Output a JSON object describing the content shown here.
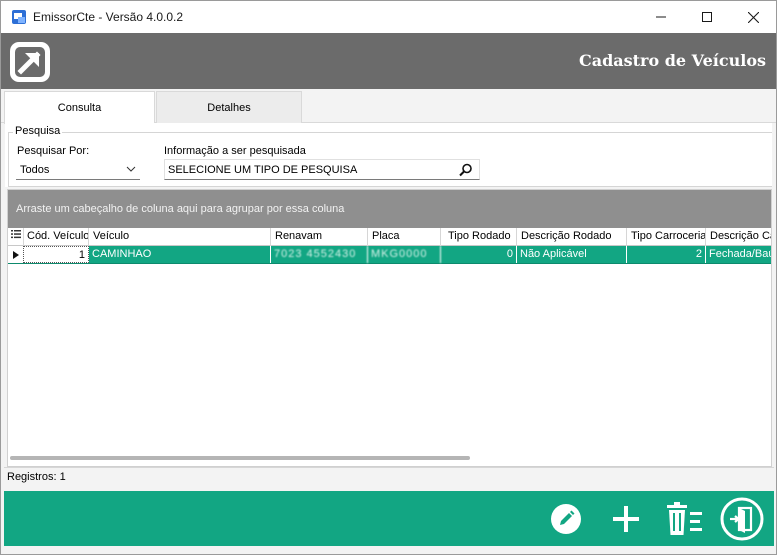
{
  "window": {
    "title": "EmissorCte - Versão 4.0.0.2",
    "icon": "app-icon"
  },
  "header": {
    "title": "Cadastro de Veículos",
    "logo": "arrow-logo-icon",
    "background": "#6b6b6b"
  },
  "tabs": [
    {
      "label": "Consulta",
      "active": true
    },
    {
      "label": "Detalhes",
      "active": false
    }
  ],
  "search": {
    "legend": "Pesquisa",
    "por_label": "Pesquisar Por:",
    "por_value": "Todos",
    "info_label": "Informação a ser pesquisada",
    "info_value": "SELECIONE UM TIPO DE PESQUISA"
  },
  "grid": {
    "group_panel_text": "Arraste um cabeçalho de coluna aqui para agrupar por essa coluna",
    "columns": [
      "Cód. Veículo",
      "Veículo",
      "Renavam",
      "Placa",
      "Tipo Rodado",
      "Descrição Rodado",
      "Tipo Carroceria",
      "Descrição Ca"
    ],
    "rows": [
      {
        "cod": "1",
        "veiculo": "CAMINHAO",
        "renavam": "7023 4552430",
        "placa": "MKG0000",
        "tipo_rodado": "0",
        "descricao_rodado": "Não Aplicável",
        "tipo_carroceria": "2",
        "descricao_carroceria": "Fechada/Baú"
      }
    ],
    "selection_color": "#12a683"
  },
  "status": {
    "registros": "Registros: 1"
  },
  "footer": {
    "background": "#12a683",
    "buttons": [
      "edit-icon",
      "add-icon",
      "delete-icon",
      "exit-icon"
    ]
  }
}
